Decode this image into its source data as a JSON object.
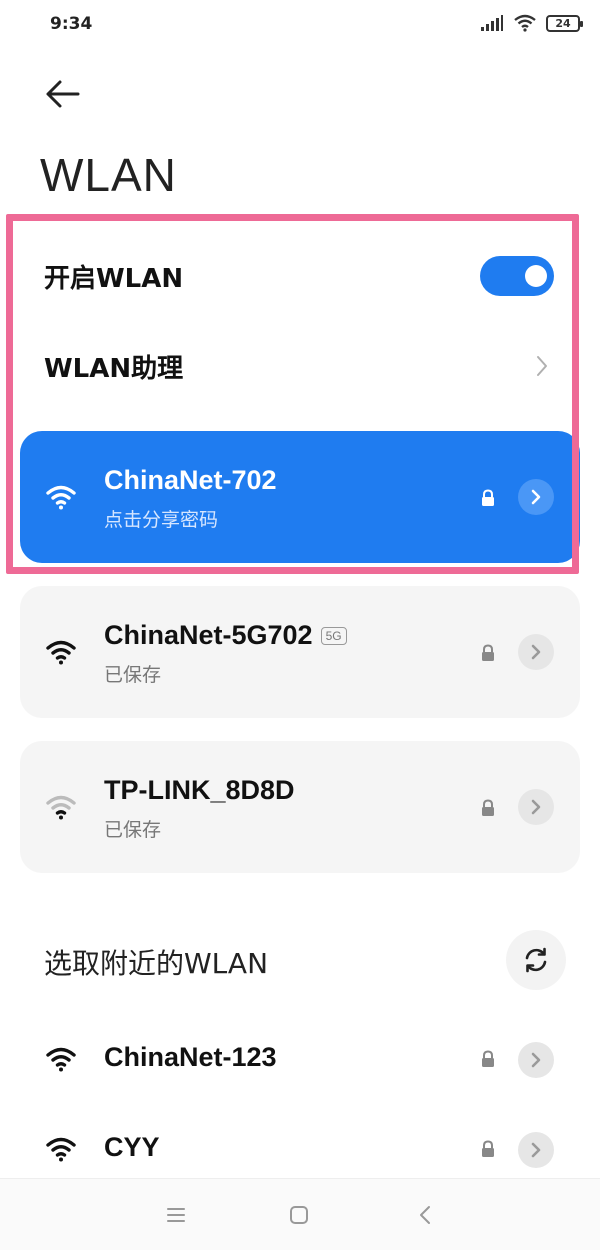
{
  "status_bar": {
    "time": "9:34",
    "battery": "24"
  },
  "header": {
    "title": "WLAN"
  },
  "settings": {
    "wlan_toggle_label": "开启WLAN",
    "wlan_enabled": true,
    "assistant_label": "WLAN助理"
  },
  "saved_networks": [
    {
      "name": "ChinaNet-702",
      "subtitle": "点击分享密码",
      "connected": true,
      "secured": true
    },
    {
      "name": "ChinaNet-5G702",
      "badge": "5G",
      "subtitle": "已保存",
      "connected": false,
      "secured": true
    },
    {
      "name": "TP-LINK_8D8D",
      "subtitle": "已保存",
      "connected": false,
      "secured": true
    }
  ],
  "nearby": {
    "section_title": "选取附近的WLAN",
    "networks": [
      {
        "name": "ChinaNet-123",
        "secured": true
      },
      {
        "name": "CYY",
        "secured": true
      }
    ]
  },
  "colors": {
    "accent": "#1f7cf0",
    "highlight": "#ee6a96"
  },
  "nav_bar": {
    "icons": [
      "menu-icon",
      "home-icon",
      "back-icon"
    ]
  }
}
